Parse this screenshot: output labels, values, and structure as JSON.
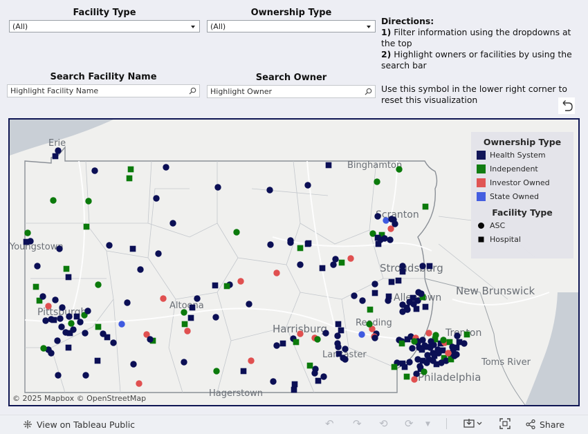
{
  "filters": {
    "facility_type": {
      "label": "Facility Type",
      "value": "(All)"
    },
    "ownership_type": {
      "label": "Ownership Type",
      "value": "(All)"
    },
    "search_facility": {
      "label": "Search Facility Name",
      "placeholder": "Highlight Facility Name"
    },
    "search_owner": {
      "label": "Search Owner",
      "placeholder": "Highlight Owner"
    }
  },
  "directions": {
    "title": "Directions:",
    "step1_num": "1)",
    "step1": "Filter information using the dropdowns at the top",
    "step2_num": "2)",
    "step2": "Highlight owners or facilities by using the search bar",
    "reset_note": "Use this symbol in the lower right corner to reset this visualization"
  },
  "legend": {
    "ownership_title": "Ownership Type",
    "ownership": [
      {
        "label": "Health System",
        "color": "#0b0f55"
      },
      {
        "label": "Independent",
        "color": "#0b7a0b"
      },
      {
        "label": "Investor Owned",
        "color": "#e05050"
      },
      {
        "label": "State Owned",
        "color": "#3f5ae0"
      }
    ],
    "facility_title": "Facility Type",
    "facility": [
      {
        "label": "ASC",
        "shape": "circle"
      },
      {
        "label": "Hospital",
        "shape": "square"
      }
    ]
  },
  "map_labels": [
    "Erie",
    "Binghamton",
    "Scranton",
    "Pittsburgh",
    "Altoona",
    "Harrisburg",
    "Reading",
    "Lancaster",
    "Allentown",
    "Trenton",
    "New Brunswick",
    "Toms River",
    "Philadelphia",
    "Hagerstown",
    "East Stroudsburg",
    "Youngstown"
  ],
  "map_label_display": {
    "Erie": "Erie",
    "Binghamton": "Binghamton",
    "Scranton": "Scranton",
    "Pittsburgh": "Pittsburgh",
    "Altoona": "Altoona",
    "Harrisburg": "Harrisburg",
    "Reading": "Reading",
    "Lancaster": "Lancaster",
    "Allentown": "Allentown",
    "Trenton": "Trenton",
    "New Brunswick": "New Brunswick",
    "Toms River": "Toms River",
    "Philadelphia": "Philadelphia",
    "Hagerstown": "Hagerstown",
    "East Stroudsburg": "Stroudsburg",
    "Youngstown": "Youngstown"
  },
  "attribution": "© 2025 Mapbox  © OpenStreetMap",
  "toolbar": {
    "view_on": "View on Tableau Public",
    "share": "Share"
  }
}
